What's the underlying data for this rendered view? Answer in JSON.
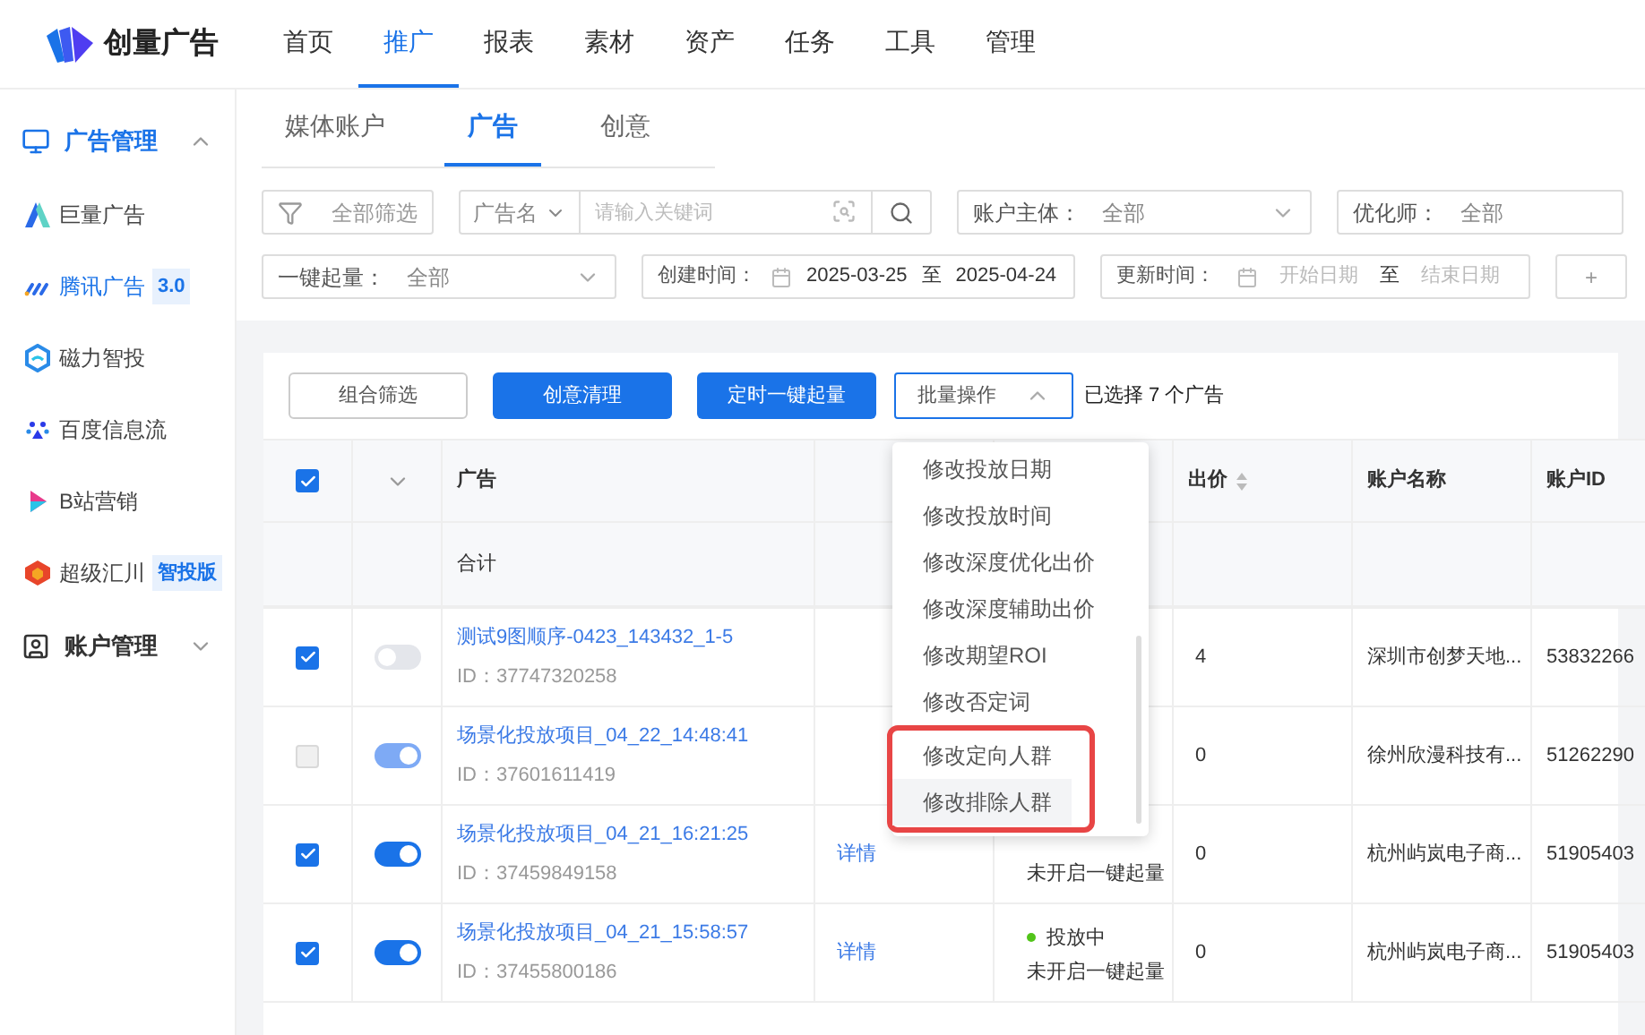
{
  "brand": {
    "name": "创量广告"
  },
  "nav": [
    {
      "label": "首页",
      "selected": false
    },
    {
      "label": "推广",
      "selected": true
    },
    {
      "label": "报表",
      "selected": false
    },
    {
      "label": "素材",
      "selected": false
    },
    {
      "label": "资产",
      "selected": false
    },
    {
      "label": "任务",
      "selected": false
    },
    {
      "label": "工具",
      "selected": false
    },
    {
      "label": "管理",
      "selected": false
    }
  ],
  "sidebar": {
    "groups": [
      {
        "label": "广告管理",
        "selected": true,
        "expanded": true,
        "items": [
          {
            "label": "巨量广告",
            "selected": false
          },
          {
            "label": "腾讯广告",
            "badge": "3.0",
            "selected": true
          },
          {
            "label": "磁力智投",
            "selected": false
          },
          {
            "label": "百度信息流",
            "selected": false
          },
          {
            "label": "B站营销",
            "selected": false
          },
          {
            "label": "超级汇川",
            "badge": "智投版",
            "selected": false
          }
        ]
      },
      {
        "label": "账户管理",
        "selected": false,
        "expanded": false
      }
    ]
  },
  "tabs": [
    {
      "label": "媒体账户",
      "selected": false
    },
    {
      "label": "广告",
      "selected": true
    },
    {
      "label": "创意",
      "selected": false
    }
  ],
  "filters": {
    "all_filter": "全部筛选",
    "name_select": "广告名",
    "keyword_placeholder": "请输入关键词",
    "account_subject": {
      "label": "账户主体：",
      "value": "全部"
    },
    "optimizer": {
      "label": "优化师：",
      "value": "全部"
    },
    "boost": {
      "label": "一键起量：",
      "value": "全部"
    },
    "created": {
      "label": "创建时间：",
      "start": "2025-03-25",
      "sep": "至",
      "end": "2025-04-24"
    },
    "updated": {
      "label": "更新时间：",
      "start_placeholder": "开始日期",
      "sep": "至",
      "end_placeholder": "结束日期"
    },
    "add_button": "+"
  },
  "toolbar": {
    "buttons": [
      {
        "label": "组合筛选",
        "kind": "outline"
      },
      {
        "label": "创意清理",
        "kind": "primary"
      },
      {
        "label": "定时一键起量",
        "kind": "primary"
      }
    ],
    "batch": {
      "label": "批量操作",
      "expanded": true
    },
    "selection": "已选择 7 个广告"
  },
  "batch_menu": [
    {
      "label": "修改投放日期",
      "hovered": false,
      "annotated": false
    },
    {
      "label": "修改投放时间",
      "hovered": false,
      "annotated": false
    },
    {
      "label": "修改深度优化出价",
      "hovered": false,
      "annotated": false
    },
    {
      "label": "修改深度辅助出价",
      "hovered": false,
      "annotated": false
    },
    {
      "label": "修改期望ROI",
      "hovered": false,
      "annotated": false
    },
    {
      "label": "修改否定词",
      "hovered": false,
      "annotated": false
    },
    {
      "label": "修改定向人群",
      "hovered": false,
      "annotated": true
    },
    {
      "label": "修改排除人群",
      "hovered": true,
      "annotated": true
    }
  ],
  "table": {
    "header": {
      "select_all": true,
      "name": "广告",
      "bid": "出价",
      "account_name": "账户名称",
      "account_id": "账户ID"
    },
    "total_row": {
      "label": "合计"
    },
    "rows": [
      {
        "checked": true,
        "disabled": false,
        "on": false,
        "name": "测试9图顺序-0423_143432_1-5",
        "id": "ID：37747320258",
        "bid": "4",
        "account_name": "深圳市创梦天地...",
        "account_id": "53832266"
      },
      {
        "checked": false,
        "disabled": true,
        "on": true,
        "name": "场景化投放项目_04_22_14:48:41",
        "id": "ID：37601611419",
        "bid": "0",
        "account_name": "徐州欣漫科技有...",
        "account_id": "51262290"
      },
      {
        "checked": true,
        "disabled": false,
        "on": true,
        "name": "场景化投放项目_04_21_16:21:25",
        "id": "ID：37459849158",
        "action": "详情",
        "status_note": "未开启一键起量",
        "bid": "0",
        "account_name": "杭州屿岚电子商...",
        "account_id": "51905403"
      },
      {
        "checked": true,
        "disabled": false,
        "on": true,
        "name": "场景化投放项目_04_21_15:58:57",
        "id": "ID：37455800186",
        "action": "详情",
        "status": {
          "label": "投放中",
          "color": "#52c41a"
        },
        "status_note": "未开启一键起量",
        "bid": "0",
        "account_name": "杭州屿岚电子商...",
        "account_id": "51905403"
      }
    ]
  }
}
